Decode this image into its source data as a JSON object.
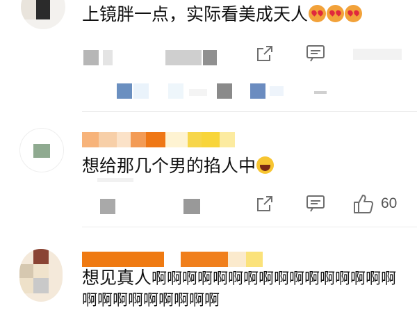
{
  "comments": [
    {
      "text": "上镜胖一点，实际看美成天人",
      "emoji": [
        "heart-eyes-emoji",
        "heart-eyes-emoji",
        "heart-eyes-emoji"
      ]
    },
    {
      "text": "想给那几个男的掐人中",
      "emoji": [
        "laughing-emoji"
      ],
      "likes": "60"
    },
    {
      "text_main": "想见真人",
      "text_tail": "啊啊啊啊啊啊啊啊啊啊啊啊啊啊啊啊啊啊啊啊啊啊啊啊啊"
    }
  ],
  "icons": {
    "share": "share-icon",
    "comment": "comment-icon",
    "like": "thumbs-up-icon"
  },
  "colors": {
    "name_orange": "#f07a10",
    "name_yellow": "#f9d72b",
    "icon_gray": "#6e6e6e"
  }
}
